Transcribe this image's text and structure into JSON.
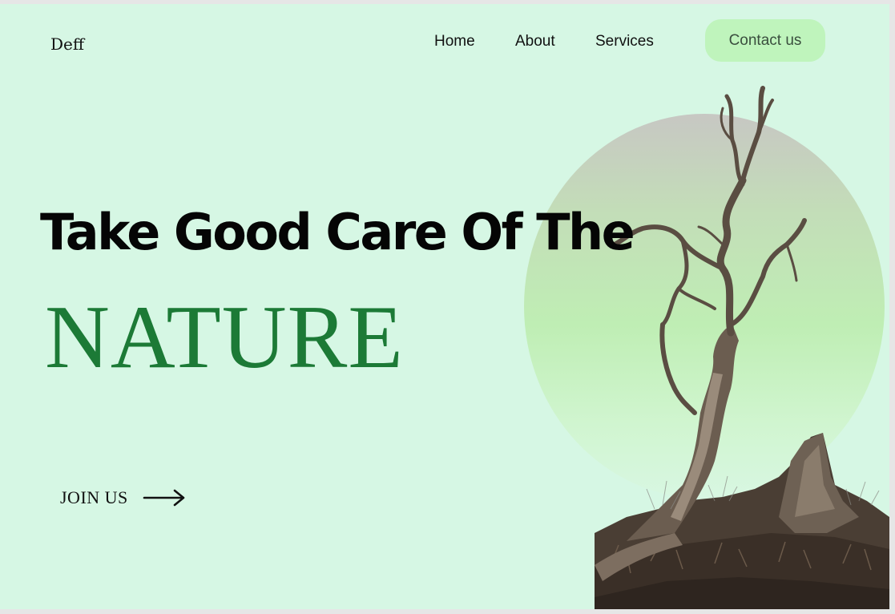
{
  "brand": {
    "logo": "Deff"
  },
  "nav": {
    "items": [
      {
        "label": "Home"
      },
      {
        "label": "About"
      },
      {
        "label": "Services"
      }
    ],
    "cta": "Contact us"
  },
  "hero": {
    "headline": "Take Good Care Of The",
    "highlight": "NATURE",
    "cta_label": "JOIN US",
    "cta_icon": "arrow-right-icon"
  },
  "image": {
    "subject": "dead-tree-photo"
  },
  "colors": {
    "background": "#d6f7e4",
    "accent_green": "#1c7a36",
    "button_bg": "#bff4bc",
    "circle_top": "#c7c7c3",
    "circle_bottom": "#bfeeb4"
  }
}
